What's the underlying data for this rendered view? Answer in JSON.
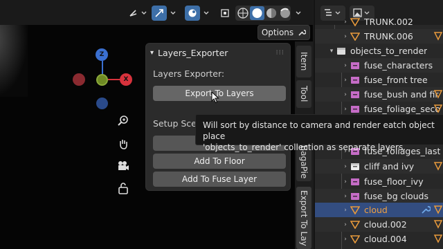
{
  "viewport": {
    "options_label": "Options",
    "gizmo": {
      "z": "Z",
      "x": "X"
    }
  },
  "panel": {
    "title": "Layers_Exporter",
    "section1_label": "Layers Exporter:",
    "export_button": "Export To Layers",
    "section2_label": "Setup Scen",
    "add_button_partial": "A",
    "add_floor_button": "Add To Floor",
    "add_fuse_button": "Add To Fuse Layer"
  },
  "tooltip": {
    "line1": "Will sort by distance to camera and render eatch object place",
    "line2": "'objects_to_render' collection as separate layers."
  },
  "ntabs": [
    "Item",
    "Tool",
    "BagaPie",
    "Export To Lay"
  ],
  "outliner": {
    "rows": [
      {
        "label": "TRUNK.002",
        "type": "object"
      },
      {
        "label": "TRUNK.006",
        "type": "object"
      },
      {
        "label": "objects_to_render",
        "type": "collection"
      },
      {
        "label": "fuse_characters",
        "type": "fuse"
      },
      {
        "label": "fuse_front tree",
        "type": "fuse"
      },
      {
        "label": "fuse_bush and fir",
        "type": "fuse"
      },
      {
        "label": "fuse_foliage_seco",
        "type": "fuse"
      },
      {
        "label": "",
        "type": "fuse"
      },
      {
        "label": "fuse_foliages_last",
        "type": "fuse"
      },
      {
        "label": "cliff and ivy",
        "type": "group"
      },
      {
        "label": "fuse_floor_ivy",
        "type": "fuse"
      },
      {
        "label": "fuse_bg clouds",
        "type": "fuse"
      },
      {
        "label": "cloud",
        "type": "object"
      },
      {
        "label": "cloud.002",
        "type": "object"
      },
      {
        "label": "cloud.004",
        "type": "object"
      }
    ]
  },
  "colors": {
    "accent_blue": "#3d6fa8",
    "selection": "#334d80",
    "fuse_pink": "#c56cc6",
    "object_orange": "#e89a3c",
    "x_axis": "#d7323c",
    "z_axis": "#3a6fd0",
    "y_axis": "#6f8a24"
  }
}
